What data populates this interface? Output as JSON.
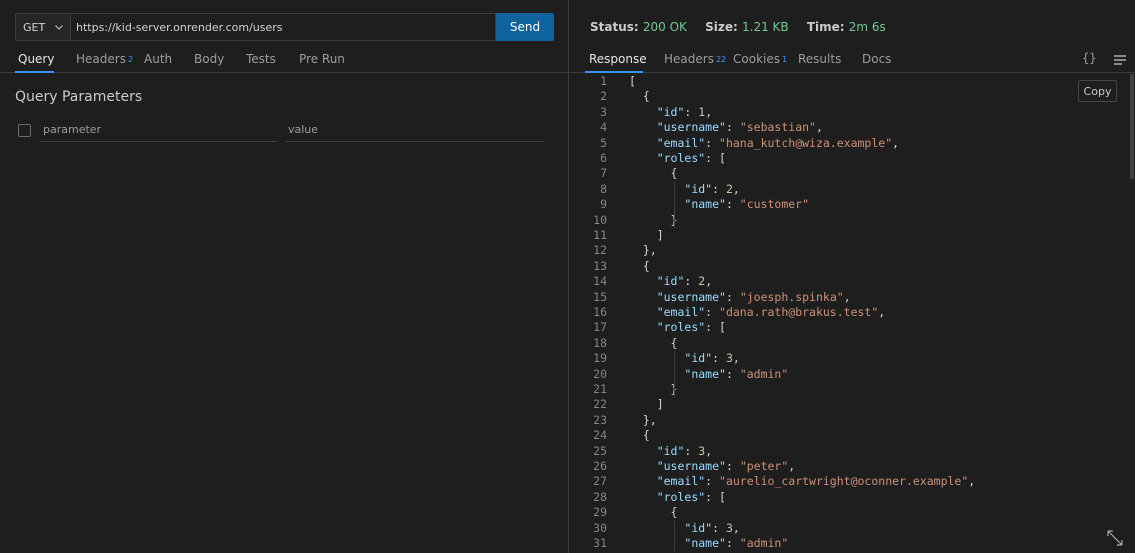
{
  "request": {
    "method": "GET",
    "url": "https://kid-server.onrender.com/users",
    "send_label": "Send"
  },
  "request_tabs": [
    {
      "label": "Query",
      "count": ""
    },
    {
      "label": "Headers",
      "count": "2"
    },
    {
      "label": "Auth",
      "count": ""
    },
    {
      "label": "Body",
      "count": ""
    },
    {
      "label": "Tests",
      "count": ""
    },
    {
      "label": "Pre Run",
      "count": ""
    }
  ],
  "query": {
    "title": "Query Parameters",
    "param_placeholder": "parameter",
    "value_placeholder": "value"
  },
  "response_status": {
    "status_label": "Status:",
    "status_value": "200 OK",
    "size_label": "Size:",
    "size_value": "1.21 KB",
    "time_label": "Time:",
    "time_value": "2m 6s"
  },
  "response_tabs": [
    {
      "label": "Response",
      "count": ""
    },
    {
      "label": "Headers",
      "count": "22"
    },
    {
      "label": "Cookies",
      "count": "1"
    },
    {
      "label": "Results",
      "count": ""
    },
    {
      "label": "Docs",
      "count": ""
    }
  ],
  "icons": {
    "braces": "{}",
    "method_chevron": "chevron-down-icon",
    "menu": "hamburger-menu-icon",
    "expand": "expand-arrows-icon"
  },
  "copy_label": "Copy",
  "colors": {
    "accent": "#3794ff",
    "send_button": "#0e639c",
    "status_ok": "#73c991",
    "json_key": "#9cdcfe",
    "json_string": "#ce9178",
    "json_number": "#b5cea8"
  },
  "code_lines": [
    "[",
    "  {",
    "    \"id\": 1,",
    "    \"username\": \"sebastian\",",
    "    \"email\": \"hana_kutch@wiza.example\",",
    "    \"roles\": [",
    "      {",
    "        \"id\": 2,",
    "        \"name\": \"customer\"",
    "      }",
    "    ]",
    "  },",
    "  {",
    "    \"id\": 2,",
    "    \"username\": \"joesph.spinka\",",
    "    \"email\": \"dana.rath@brakus.test\",",
    "    \"roles\": [",
    "      {",
    "        \"id\": 3,",
    "        \"name\": \"admin\"",
    "      }",
    "    ]",
    "  },",
    "  {",
    "    \"id\": 3,",
    "    \"username\": \"peter\",",
    "    \"email\": \"aurelio_cartwright@oconner.example\",",
    "    \"roles\": [",
    "      {",
    "        \"id\": 3,",
    "        \"name\": \"admin\""
  ]
}
